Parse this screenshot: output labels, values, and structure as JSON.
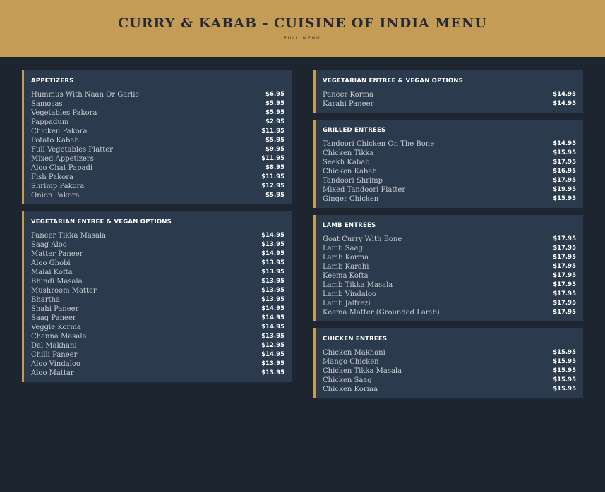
{
  "header": {
    "title": "CURRY & KABAB - CUISINE OF INDIA MENU",
    "subtitle": "FULL MENU"
  },
  "colors": {
    "accent": "#c49c55",
    "background": "#1d2531",
    "card": "#2b3a4c"
  },
  "left_column": [
    {
      "title": "APPETIZERS",
      "items": [
        {
          "name": "Hummus With Naan Or Garlic",
          "price": "$6.95"
        },
        {
          "name": "Samosas",
          "price": "$5.95"
        },
        {
          "name": "Vegetables Pakora",
          "price": "$5.95"
        },
        {
          "name": "Pappadum",
          "price": "$2.95"
        },
        {
          "name": "Chicken Pakora",
          "price": "$11.95"
        },
        {
          "name": "Potato Kabab",
          "price": "$5.95"
        },
        {
          "name": "Full Vegetables Platter",
          "price": "$9.95"
        },
        {
          "name": "Mixed Appetizers",
          "price": "$11.95"
        },
        {
          "name": "Aloo Chat Papadi",
          "price": "$8.95"
        },
        {
          "name": "Fish Pakora",
          "price": "$11.95"
        },
        {
          "name": "Shrimp Pakora",
          "price": "$12.95"
        },
        {
          "name": "Onion Pakora",
          "price": "$5.95"
        }
      ]
    },
    {
      "title": "VEGETARIAN ENTREE & VEGAN OPTIONS",
      "items": [
        {
          "name": "Paneer Tikka Masala",
          "price": "$14.95"
        },
        {
          "name": "Saag Aloo",
          "price": "$13.95"
        },
        {
          "name": "Matter Paneer",
          "price": "$14.95"
        },
        {
          "name": "Aloo Ghobi",
          "price": "$13.95"
        },
        {
          "name": "Malai Kofta",
          "price": "$13.95"
        },
        {
          "name": "Bhindi Masala",
          "price": "$13.95"
        },
        {
          "name": "Mushroom Matter",
          "price": "$13.95"
        },
        {
          "name": "Bhartha",
          "price": "$13.95"
        },
        {
          "name": "Shahi Paneer",
          "price": "$14.95"
        },
        {
          "name": "Saag Paneer",
          "price": "$14.95"
        },
        {
          "name": "Veggie Korma",
          "price": "$14.95"
        },
        {
          "name": "Channa Masala",
          "price": "$13.95"
        },
        {
          "name": "Dal Makhani",
          "price": "$12.95"
        },
        {
          "name": "Chilli Paneer",
          "price": "$14.95"
        },
        {
          "name": "Aloo Vindaloo",
          "price": "$13.95"
        },
        {
          "name": "Aloo Mattar",
          "price": "$13.95"
        }
      ]
    }
  ],
  "right_column": [
    {
      "title": "VEGETARIAN ENTREE & VEGAN OPTIONS",
      "items": [
        {
          "name": "Paneer Korma",
          "price": "$14.95"
        },
        {
          "name": "Karahi Paneer",
          "price": "$14.95"
        }
      ]
    },
    {
      "title": "GRILLED ENTREES",
      "items": [
        {
          "name": "Tandoori Chicken On The Bone",
          "price": "$14.95"
        },
        {
          "name": "Chicken Tikka",
          "price": "$15.95"
        },
        {
          "name": "Seekh Kabab",
          "price": "$17.95"
        },
        {
          "name": "Chicken Kabab",
          "price": "$16.95"
        },
        {
          "name": "Tandoori Shrimp",
          "price": "$17.95"
        },
        {
          "name": "Mixed Tandoori Platter",
          "price": "$19.95"
        },
        {
          "name": "Ginger Chicken",
          "price": "$15.95"
        }
      ]
    },
    {
      "title": "LAMB ENTREES",
      "items": [
        {
          "name": "Goat Curry With Bone",
          "price": "$17.95"
        },
        {
          "name": "Lamb Saag",
          "price": "$17.95"
        },
        {
          "name": "Lamb Korma",
          "price": "$17.95"
        },
        {
          "name": "Lamb Karahi",
          "price": "$17.95"
        },
        {
          "name": "Keema Kofta",
          "price": "$17.95"
        },
        {
          "name": "Lamb Tikka Masala",
          "price": "$17.95"
        },
        {
          "name": "Lamb Vindaloo",
          "price": "$17.95"
        },
        {
          "name": "Lamb Jalfrezi",
          "price": "$17.95"
        },
        {
          "name": "Keema Matter (Grounded Lamb)",
          "price": "$17.95"
        }
      ]
    },
    {
      "title": "CHICKEN ENTREES",
      "items": [
        {
          "name": "Chicken Makhani",
          "price": "$15.95"
        },
        {
          "name": "Mango Chicken",
          "price": "$15.95"
        },
        {
          "name": "Chicken Tikka Masala",
          "price": "$15.95"
        },
        {
          "name": "Chicken Saag",
          "price": "$15.95"
        },
        {
          "name": "Chicken Korma",
          "price": "$15.95"
        }
      ]
    }
  ]
}
